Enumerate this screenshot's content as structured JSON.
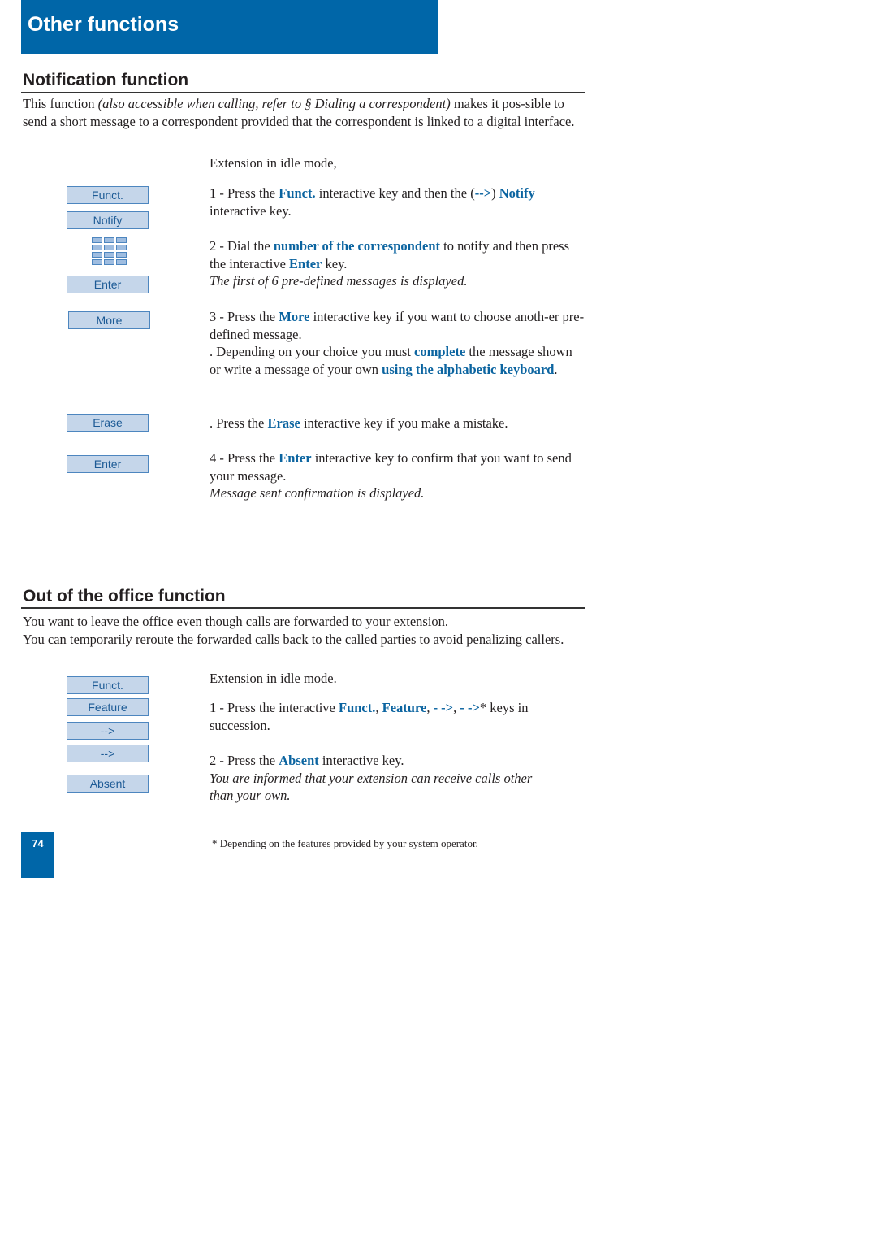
{
  "header": {
    "title": "Other functions",
    "color": "#0066a8"
  },
  "notification": {
    "title": "Notification function",
    "intro": {
      "a": "This function ",
      "italic": "(also accessible when calling, refer to § Dialing a correspondent)",
      "b": " makes it pos-sible to send a short message to a correspondent provided that the correspondent is linked to a digital interface."
    },
    "idle": "Extension in idle mode,",
    "keys": [
      "Funct.",
      "Notify",
      "Enter",
      "More",
      "Erase",
      "Enter"
    ],
    "keypad_icon": "keypad-icon",
    "step1": {
      "a": "1 - Press the ",
      "k1": "Funct.",
      "b": " interactive key and then the (",
      "arrow": "-->",
      "c": ") ",
      "k2": "Notify",
      "d": " interactive key."
    },
    "step2": {
      "a": "2 - Dial the ",
      "k1": "number of the correspondent",
      "b": " to notify and then press the interactive ",
      "k2": "Enter",
      "c": " key.",
      "note": "The first of 6 pre-defined messages is displayed."
    },
    "step3": {
      "a": "3 - Press the ",
      "k1": "More",
      "b": " interactive key if you want to choose anoth-er pre-defined message.",
      "c": ". Depending on your choice you must ",
      "k2": "complete",
      "d": " the message shown or write a message of your own ",
      "k3": "using the alphabetic keyboard",
      "e": "."
    },
    "erase": {
      "a": ". Press the ",
      "k1": "Erase",
      "b": " interactive key if you make a mistake."
    },
    "step4": {
      "a": "4 - Press the ",
      "k1": "Enter",
      "b": " interactive key to confirm that you want to send your message.",
      "note": "Message sent confirmation is displayed."
    }
  },
  "office": {
    "title": "Out of the office function",
    "intro1": "You want to leave the office even though calls are forwarded to your extension.",
    "intro2": "You can temporarily reroute the forwarded calls back to the called parties to avoid penalizing callers.",
    "idle": "Extension in idle mode.",
    "keys": [
      "Funct.",
      "Feature",
      "-->",
      "-->",
      "Absent"
    ],
    "step1": {
      "a": "1 - Press the interactive ",
      "k1": "Funct.",
      "s1": ", ",
      "k2": "Feature",
      "s2": ", ",
      "k3": "- ->",
      "s3": ", ",
      "k4": "- ->",
      "b": "* keys in succession."
    },
    "step2": {
      "a": "2 - Press the ",
      "k1": "Absent",
      "b": " interactive key.",
      "note": "You are informed that your extension can receive calls other than your own."
    }
  },
  "footer": {
    "page": "74",
    "footnote": "* Depending on the features provided by your system operator."
  }
}
